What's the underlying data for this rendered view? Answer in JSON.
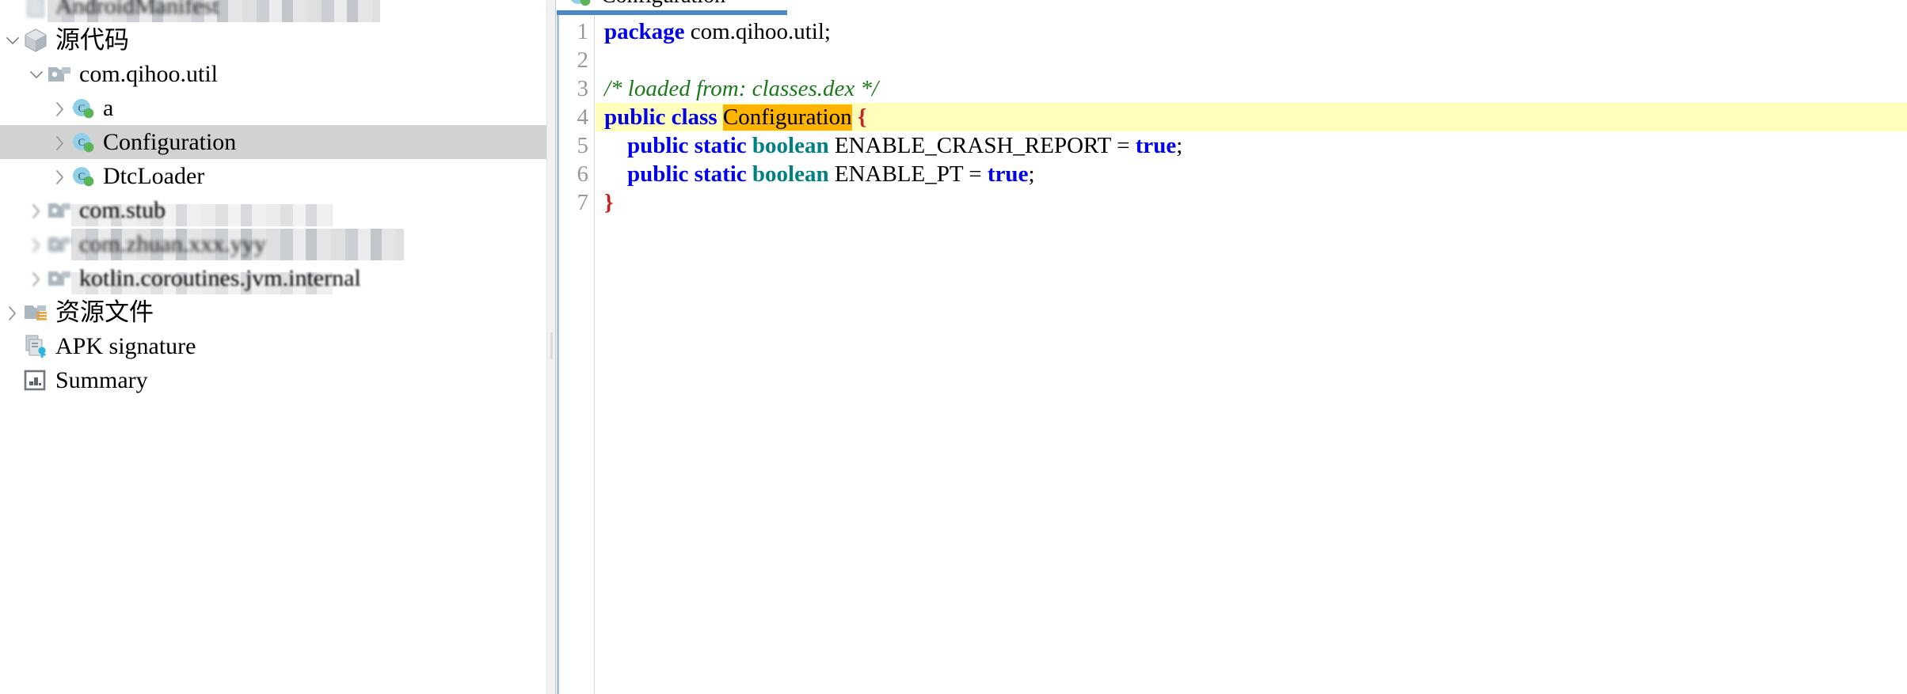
{
  "tree": {
    "rows": [
      {
        "label": "AndroidManifest",
        "icon": "xml-file-icon",
        "indent": 0,
        "chevron": "none",
        "state": "redacted-hard",
        "selected": false,
        "name": "tree-item-androidmanifest"
      },
      {
        "label": "源代码",
        "icon": "source-box-icon",
        "indent": 0,
        "chevron": "down",
        "state": "normal",
        "selected": false,
        "name": "tree-item-source-code"
      },
      {
        "label": "com.qihoo.util",
        "icon": "package-folder-icon",
        "indent": 1,
        "chevron": "down",
        "state": "normal",
        "selected": false,
        "name": "tree-item-com-qihoo-util"
      },
      {
        "label": "a",
        "icon": "java-class-icon",
        "indent": 2,
        "chevron": "right",
        "state": "normal",
        "selected": false,
        "name": "tree-item-class-a"
      },
      {
        "label": "Configuration",
        "icon": "java-class-icon",
        "indent": 2,
        "chevron": "right",
        "state": "normal",
        "selected": true,
        "name": "tree-item-class-configuration"
      },
      {
        "label": "DtcLoader",
        "icon": "java-class-icon",
        "indent": 2,
        "chevron": "right",
        "state": "normal",
        "selected": false,
        "name": "tree-item-class-dtcloader"
      },
      {
        "label": "com.stub",
        "icon": "package-folder-icon",
        "indent": 1,
        "chevron": "right",
        "state": "redacted-soft",
        "selected": false,
        "name": "tree-item-com-stub"
      },
      {
        "label": "com.zhuan.xxx.yyy",
        "icon": "package-folder-icon",
        "indent": 1,
        "chevron": "right",
        "state": "redacted-hard",
        "selected": false,
        "name": "tree-item-redacted-package"
      },
      {
        "label": "kotlin.coroutines.jvm.internal",
        "icon": "package-folder-icon",
        "indent": 1,
        "chevron": "right",
        "state": "redacted-soft",
        "selected": false,
        "name": "tree-item-kotlin-coroutines-jvm-internal"
      },
      {
        "label": "资源文件",
        "icon": "resource-folder-icon",
        "indent": 0,
        "chevron": "right",
        "state": "normal",
        "selected": false,
        "name": "tree-item-resource-files"
      },
      {
        "label": "APK signature",
        "icon": "apk-signature-icon",
        "indent": 0,
        "chevron": "none",
        "state": "normal",
        "selected": false,
        "name": "tree-item-apk-signature"
      },
      {
        "label": "Summary",
        "icon": "summary-icon",
        "indent": 0,
        "chevron": "none",
        "state": "normal",
        "selected": false,
        "name": "tree-item-summary"
      }
    ]
  },
  "editor": {
    "tab": {
      "title": "Configuration",
      "icon": "java-class-icon"
    },
    "line_numbers": [
      "1",
      "2",
      "3",
      "4",
      "5",
      "6",
      "7"
    ],
    "code": [
      {
        "n": "1",
        "highlight": false,
        "tokens": [
          {
            "t": "package",
            "c": "kw"
          },
          {
            "t": " ",
            "c": "pln"
          },
          {
            "t": "com.qihoo.util;",
            "c": "pln"
          }
        ]
      },
      {
        "n": "2",
        "highlight": false,
        "tokens": []
      },
      {
        "n": "3",
        "highlight": false,
        "tokens": [
          {
            "t": "/* loaded from: classes.dex */",
            "c": "cmt"
          }
        ]
      },
      {
        "n": "4",
        "highlight": true,
        "tokens": [
          {
            "t": "public class",
            "c": "kw"
          },
          {
            "t": " ",
            "c": "pln"
          },
          {
            "t": "Configuration",
            "c": "match"
          },
          {
            "t": " ",
            "c": "pln"
          },
          {
            "t": "{",
            "c": "brc"
          }
        ]
      },
      {
        "n": "5",
        "highlight": false,
        "tokens": [
          {
            "t": "    ",
            "c": "pln"
          },
          {
            "t": "public static",
            "c": "kw"
          },
          {
            "t": " ",
            "c": "pln"
          },
          {
            "t": "boolean",
            "c": "typ"
          },
          {
            "t": " ENABLE_CRASH_REPORT ",
            "c": "pln"
          },
          {
            "t": "=",
            "c": "opr"
          },
          {
            "t": " ",
            "c": "pln"
          },
          {
            "t": "true",
            "c": "kw"
          },
          {
            "t": ";",
            "c": "pln"
          }
        ]
      },
      {
        "n": "6",
        "highlight": false,
        "tokens": [
          {
            "t": "    ",
            "c": "pln"
          },
          {
            "t": "public static",
            "c": "kw"
          },
          {
            "t": " ",
            "c": "pln"
          },
          {
            "t": "boolean",
            "c": "typ"
          },
          {
            "t": " ENABLE_PT ",
            "c": "pln"
          },
          {
            "t": "=",
            "c": "opr"
          },
          {
            "t": " ",
            "c": "pln"
          },
          {
            "t": "true",
            "c": "kw"
          },
          {
            "t": ";",
            "c": "pln"
          }
        ]
      },
      {
        "n": "7",
        "highlight": false,
        "tokens": [
          {
            "t": "}",
            "c": "brc"
          }
        ]
      }
    ]
  },
  "colors": {
    "selection_background": "#d2d2d2",
    "line_highlight": "#ffffbb",
    "search_match": "#ffb400",
    "keyword": "#0000ee",
    "type": "#008080",
    "comment": "#1a7a1a",
    "brace": "#cc2222",
    "tab_underline": "#4a88c7",
    "gutter_text": "#999999",
    "class_icon_circle": "#8fd0e8",
    "class_icon_dot": "#5ab55a",
    "folder_icon": "#a8b4bd",
    "resource_icon_lines": "#e8a33d",
    "key_icon": "#29b6d8"
  }
}
